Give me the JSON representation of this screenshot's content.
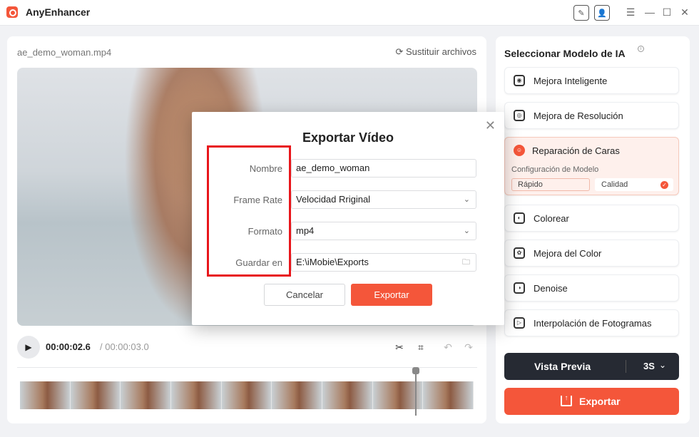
{
  "app": {
    "title": "AnyEnhancer"
  },
  "editor": {
    "file_name": "ae_demo_woman.mp4",
    "replace_label": "Sustituir archivos",
    "time_current": "00:00:02.6",
    "time_total": "/ 00:00:03.0"
  },
  "models": {
    "title": "Seleccionar Modelo de IA",
    "items": [
      {
        "label": "Mejora Inteligente",
        "icon": "robot-icon"
      },
      {
        "label": "Mejora de Resolución",
        "icon": "resolution-icon"
      },
      {
        "label": "Reparación de Caras",
        "icon": "face-icon"
      },
      {
        "label": "Colorear",
        "icon": "palette-icon"
      },
      {
        "label": "Mejora del Color",
        "icon": "color-circles-icon"
      },
      {
        "label": "Denoise",
        "icon": "denoise-icon"
      },
      {
        "label": "Interpolación de Fotogramas",
        "icon": "frames-icon"
      }
    ],
    "config_label": "Configuración de Modelo",
    "option_fast": "Rápido",
    "option_quality": "Calidad",
    "selected_option": "Calidad"
  },
  "preview": {
    "label": "Vista Previa",
    "duration": "3S"
  },
  "export_button": {
    "label": "Exportar"
  },
  "dialog": {
    "title": "Exportar Vídeo",
    "fields": {
      "name_label": "Nombre",
      "name_value": "ae_demo_woman",
      "framerate_label": "Frame Rate",
      "framerate_value": "Velocidad Rriginal",
      "format_label": "Formato",
      "format_value": "mp4",
      "save_label": "Guardar en",
      "save_value": "E:\\iMobie\\Exports"
    },
    "cancel_label": "Cancelar",
    "export_label": "Exportar"
  },
  "colors": {
    "accent": "#f4563a",
    "highlight": "#e8161b",
    "dark_button": "#262a33"
  }
}
